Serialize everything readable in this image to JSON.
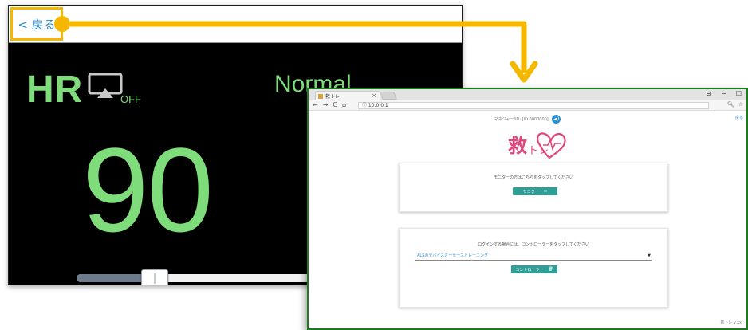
{
  "monitor": {
    "back_label": "< 戻る",
    "hr_label": "HR",
    "off_label": "OFF",
    "status": "Normal",
    "hr_value": "90",
    "slider_fraction": 0.25
  },
  "browser": {
    "tab_title": "救トレ",
    "tab_close": "×",
    "url": "10.0.0.1",
    "window_controls": [
      "⊖",
      "−",
      "☐"
    ],
    "page": {
      "top_text": "マネジャー/ID: [ID.0000000]",
      "corner_link": "戻る",
      "card1_text": "モニターの方はこちらをタップしてください",
      "card1_button": "モニター",
      "card2_text": "ログインする場合には、コントローラーをタップしてください",
      "select_value": "ALSのデバイスオーセーストレーニング",
      "card2_button": "コントローラー",
      "footer": "救トレ v.xx"
    }
  },
  "colors": {
    "callout": "#f5b800",
    "hr_green": "#7fdc7a",
    "teal": "#2e9e96",
    "accent_blue": "#2b8fd6",
    "logo_pink": "#e0457b"
  }
}
